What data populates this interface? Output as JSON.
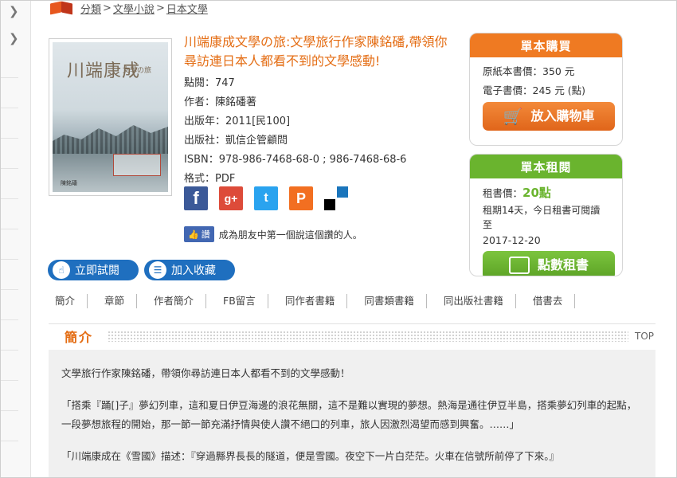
{
  "breadcrumb": {
    "root": "分類",
    "cat1": "文學小說",
    "cat2": "日本文學",
    "sep": ">"
  },
  "cover": {
    "title": "川端康成",
    "subtitle": "文學の旅",
    "author": "陳銘磻"
  },
  "book": {
    "title": "川端康成文學の旅:文學旅行作家陳銘磻,帶領你尋訪連日本人都看不到的文學感動!",
    "views_label": "點閱：",
    "views": "747",
    "author_label": "作者：",
    "author": "陳銘磻著",
    "year_label": "出版年：",
    "year": "2011[民100]",
    "publisher_label": "出版社：",
    "publisher": "凱信企管顧問",
    "isbn_label": "ISBN：",
    "isbn": "978-986-7468-68-0 ; 986-7468-68-6",
    "format_label": "格式：",
    "format": "PDF"
  },
  "social": {
    "fb": "f",
    "gplus": "g+",
    "twitter": "t",
    "plurk": "P"
  },
  "fb_like": {
    "button": "讚",
    "text": "成為朋友中第一個說這個讚的人。"
  },
  "actions": {
    "trial": "立即試閱",
    "favorite": "加入收藏"
  },
  "purchase": {
    "header": "單本購買",
    "paper_price": "原紙本書價：350 元",
    "ebook_price": "電子書價：245 元 (點)",
    "cart_button": "放入購物車",
    "color": "#ef7a22"
  },
  "rent": {
    "header": "單本租閱",
    "price_label": "租書價：",
    "price": "20點",
    "period": "租期14天，今日租書可閱讀至",
    "until": "2017-12-20",
    "rent_button": "點數租書",
    "color": "#6ab42e"
  },
  "tabs": [
    "簡介",
    "章節",
    "作者簡介",
    "FB留言",
    "同作者書籍",
    "同書類書籍",
    "同出版社書籍",
    "借書去"
  ],
  "section": {
    "title": "簡介",
    "top": "TOP"
  },
  "intro": {
    "p1": "文學旅行作家陳銘磻，帶領你尋訪連日本人都看不到的文學感動！",
    "p2": "「搭乘『踊[]子』夢幻列車，這和夏日伊豆海邊的浪花無關，這不是難以實現的夢想。熱海是通往伊豆半島，搭乘夢幻列車的起點，一段夢想旅程的開始，那一節一節充滿抒情與使人讚不絕口的列車，旅人因激烈渴望而感到興奮。……」",
    "p3": "「川端康成在《雪國》描述：『穿過縣界長長的隧道，便是雪國。夜空下一片白茫茫。火車在信號所前停了下來。』"
  }
}
